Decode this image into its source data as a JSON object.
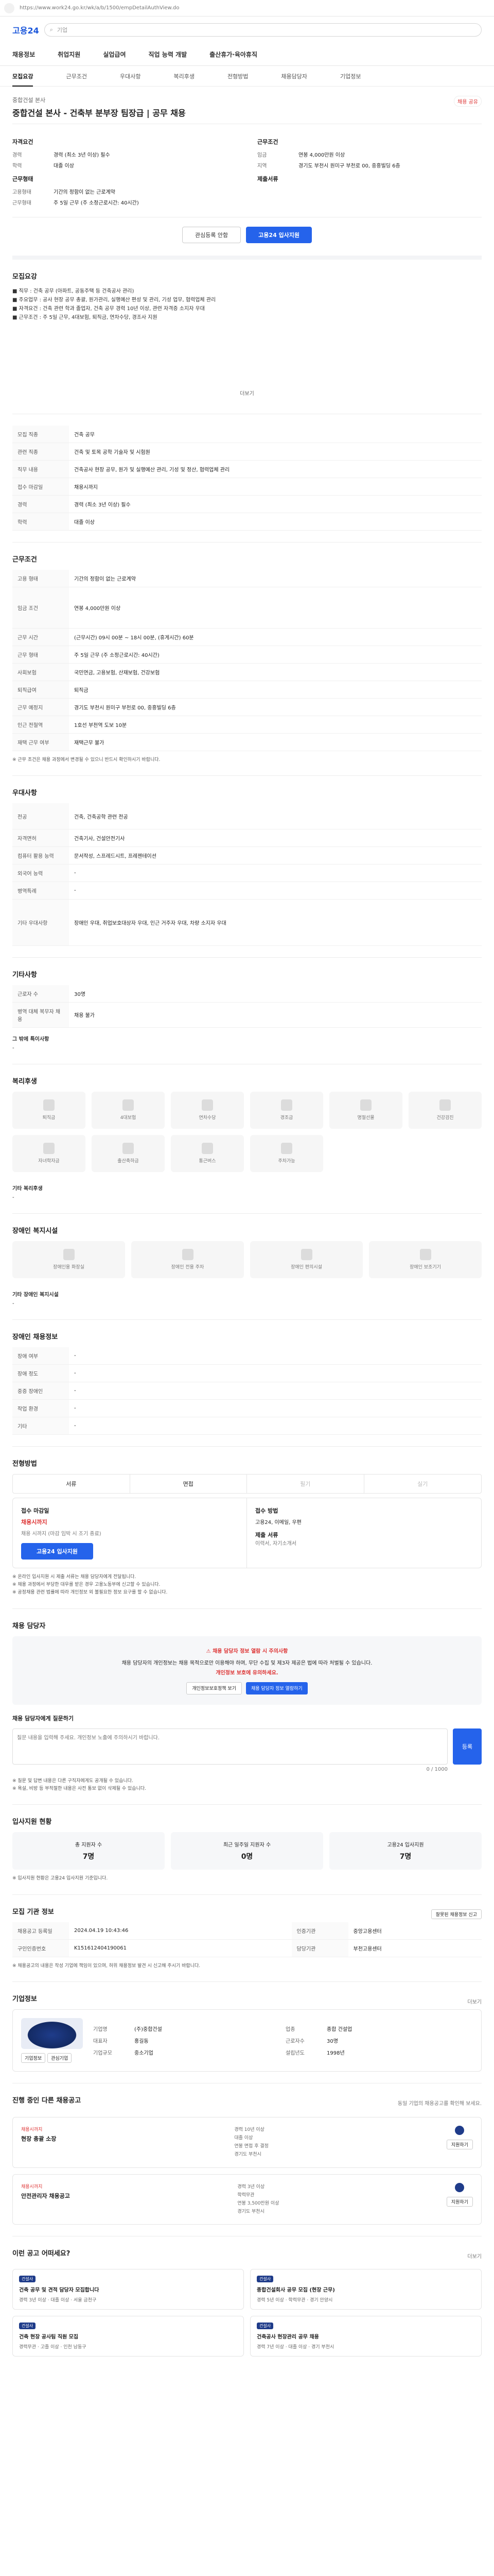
{
  "browser": {
    "url": "https://www.work24.go.kr/wk/a/b/1500/empDetailAuthView.do"
  },
  "brand": {
    "name": "고용24"
  },
  "search": {
    "placeholder": "기업"
  },
  "gnb": [
    "채용정보",
    "취업지원",
    "실업급여",
    "직업 능력 개발",
    "출산휴가·육아휴직"
  ],
  "tabs": [
    "모집요강",
    "근무조건",
    "우대사항",
    "복리후생",
    "전형방법",
    "채용담당자",
    "기업정보"
  ],
  "job": {
    "company": "중합건설 본사",
    "title": "중합건설 본사 - 건축부 분부장 팀장급 | 공무 채용",
    "share": "채용 공유"
  },
  "summary": {
    "left_title": "자격요건",
    "left": [
      {
        "k": "경력",
        "v": "경력 (최소 3년 이상) 필수"
      },
      {
        "k": "학력",
        "v": "대졸 이상"
      }
    ],
    "left_title2": "근무형태",
    "left2": [
      {
        "k": "고용형태",
        "v": "기간의 정함이 없는 근로계약"
      },
      {
        "k": "근무형태",
        "v": "주 5일 근무 (주 소정근로시간: 40시간)"
      }
    ],
    "right_title": "근무조건",
    "right": [
      {
        "k": "임금",
        "v": "연봉 4,000만원 이상"
      },
      {
        "k": "지역",
        "v": "경기도 부천시 원미구 부천로 00, 중흥빌딩 6층"
      }
    ],
    "right_title2": "제출서류",
    "right2": []
  },
  "buttons": {
    "scrap": "관심등록 안함",
    "apply": "고용24 입사지원"
  },
  "recruit": {
    "title": "모집요강",
    "body": [
      "■ 직무 : 건축 공무 (아파트, 공동주택 등 건축공사 관리)",
      "■ 주요업무 : 공사 현장 공무 총괄, 원가관리, 실행예산 편성 및 관리, 기성 업무, 협력업체 관리",
      "■ 자격요건 : 건축 관련 학과 졸업자, 건축 공무 경력 10년 이상, 관련 자격증 소지자 우대",
      "■ 근무조건 : 주 5일 근무, 4대보험, 퇴직금, 연차수당, 경조사 지원"
    ],
    "more": "더보기"
  },
  "recruit_table": [
    {
      "k": "모집 직종",
      "v": "건축 공무"
    },
    {
      "k": "관련 직종",
      "v": "건축 및 토목 공학 기술자 및 시험원"
    },
    {
      "k": "직무 내용",
      "v": "건축공사 현장 공무, 원가 및 실행예산 관리, 기성 및 정산, 협력업체 관리"
    },
    {
      "k": "접수 마감일",
      "v": "채용시까지"
    },
    {
      "k": "경력",
      "v": "경력 (최소 3년 이상) 필수"
    },
    {
      "k": "학력",
      "v": "대졸 이상"
    }
  ],
  "work": {
    "title": "근무조건",
    "rows": [
      {
        "k": "고용 형태",
        "v": "기간의 정함이 없는 근로계약"
      },
      {
        "k": "임금 조건",
        "v": "연봉 4,000만원 이상"
      },
      {
        "k": "근무 시간",
        "v": "(근무시간) 09시 00분 ~ 18시 00분, (휴게시간) 60분"
      },
      {
        "k": "근무 형태",
        "v": "주 5일 근무 (주 소정근로시간: 40시간)"
      },
      {
        "k": "사회보험",
        "v": "국민연금, 고용보험, 산재보험, 건강보험"
      },
      {
        "k": "퇴직급여",
        "v": "퇴직금"
      },
      {
        "k": "근무 예정지",
        "v": "경기도 부천시 원미구 부천로 00, 중흥빌딩 6층"
      },
      {
        "k": "인근 전철역",
        "v": "1호선 부천역 도보 10분"
      },
      {
        "k": "재택 근무 여부",
        "v": "재택근무 불가"
      }
    ],
    "note": "※ 근무 조건은 채용 과정에서 변경될 수 있으니 반드시 확인하시기 바랍니다."
  },
  "prefer": {
    "title": "우대사항",
    "rows": [
      {
        "k": "전공",
        "v": "건축, 건축공학 관련 전공"
      },
      {
        "k": "자격면허",
        "v": "건축기사, 건설안전기사"
      },
      {
        "k": "컴퓨터 활용 능력",
        "v": "문서작성, 스프레드시트, 프레젠테이션"
      },
      {
        "k": "외국어 능력",
        "v": "-"
      },
      {
        "k": "병역특례",
        "v": "-"
      },
      {
        "k": "기타 우대사항",
        "v": "장애인 우대, 취업보호대상자 우대, 인근 거주자 우대, 차량 소지자 우대"
      }
    ]
  },
  "extra": {
    "title": "기타사항",
    "rows": [
      {
        "k": "근로자 수",
        "v": "30명"
      },
      {
        "k": "병역 대체 복무자 채용",
        "v": "채용 불가"
      }
    ],
    "sub": "그 밖에 특이사항",
    "sub_v": "-"
  },
  "welfare": {
    "title": "복리후생",
    "items": [
      "퇴직금",
      "4대보험",
      "연차수당",
      "경조금",
      "명절선물",
      "건강검진",
      "자녀학자금",
      "출산축하금",
      "통근버스",
      "주차가능"
    ],
    "note_title": "기타 복리후생",
    "note_v": "-"
  },
  "disabled": {
    "title": "장애인 복지시설",
    "items": [
      "장애인용 화장실",
      "장애인 전용 주차",
      "장애인 편의시설",
      "장애인 보조기기"
    ],
    "note_title": "기타 장애인 복지시설",
    "note_v": "-"
  },
  "disabled_req": {
    "title": "장애인 채용정보",
    "rows": [
      {
        "k": "장애 여부",
        "v": "-"
      },
      {
        "k": "장애 정도",
        "v": "-"
      },
      {
        "k": "중증 장애인",
        "v": "-"
      },
      {
        "k": "작업 환경",
        "v": "-"
      },
      {
        "k": "기타",
        "v": "-"
      }
    ]
  },
  "process": {
    "title": "전형방법",
    "steps": [
      "서류",
      "면접",
      "필기",
      "실기"
    ],
    "left_title": "접수 마감일",
    "left_value": "채용시까지",
    "left_sub": "채용 시까지 (마감 임박 시 조기 종료)",
    "apply_btn": "고용24 입사지원",
    "right_title": "접수 방법",
    "right_values": [
      "고용24",
      "이메일",
      "우편"
    ],
    "right_sub": "제출 서류",
    "right_sub_v": "이력서, 자기소개서",
    "notice": [
      "※ 온라인 입사지원 시 제출 서류는 채용 담당자에게 전달됩니다.",
      "※ 채용 과정에서 부당한 대우를 받은 경우 고용노동부에 신고할 수 있습니다.",
      "※ 공정채용 관련 법률에 따라 개인정보 외 불필요한 정보 요구를 할 수 없습니다."
    ]
  },
  "contact": {
    "title": "채용 담당자",
    "alert_head": "채용 담당자 정보 열람 시 주의사항",
    "alert_body": "채용 담당자의 개인정보는 채용 목적으로만 이용해야 하며, 무단 수집 및 제3자 제공은 법에 따라 처벌될 수 있습니다.",
    "alert_red": "개인정보 보호에 유의하세요.",
    "btn1": "개인정보보호정책 보기",
    "btn2": "채용 담당자 정보 열람하기",
    "qa_title": "채용 담당자에게 질문하기",
    "qa_placeholder": "질문 내용을 입력해 주세요. 개인정보 노출에 주의하시기 바랍니다.",
    "qa_count": "0 / 1000",
    "qa_btn": "등록",
    "qa_notes": [
      "※ 질문 및 답변 내용은 다른 구직자에게도 공개될 수 있습니다.",
      "※ 욕설, 비방 등 부적절한 내용은 사전 통보 없이 삭제될 수 있습니다."
    ]
  },
  "applicants": {
    "title": "입사지원 현황",
    "stats": [
      {
        "label": "총 지원자 수",
        "num": "7명"
      },
      {
        "label": "최근 일주일 지원자 수",
        "num": "0명"
      },
      {
        "label": "고용24 입사지원",
        "num": "7명"
      }
    ],
    "note": "※ 입사지원 현황은 고용24 입사지원 기준입니다."
  },
  "meta": {
    "title": "모집 기관 정보",
    "report_btn": "잘못된 채용정보 신고",
    "rows": [
      {
        "k": "채용공고 등록일",
        "v": "2024.04.19 10:43:46",
        "k2": "인증기관",
        "v2": "중앙고용센터"
      },
      {
        "k": "구인인증번호",
        "v": "K151612404190061",
        "k2": "담당기관",
        "v2": "부천고용센터"
      }
    ],
    "note": "※ 채용공고의 내용은 작성 기업에 책임이 있으며, 허위 채용정보 발견 시 신고해 주시기 바랍니다."
  },
  "company": {
    "title": "기업정보",
    "more": "더보기",
    "rows": [
      {
        "k": "기업명",
        "v": "(주)중합건설",
        "k2": "업종",
        "v2": "종합 건설업"
      },
      {
        "k": "대표자",
        "v": "홍길동",
        "k2": "근로자수",
        "v2": "30명"
      },
      {
        "k": "기업규모",
        "v": "중소기업",
        "k2": "설립년도",
        "v2": "1998년"
      }
    ],
    "btn1": "기업정보",
    "btn2": "관심기업"
  },
  "others": {
    "title": "진행 중인 다른 채용공고",
    "sub": "동일 기업의 채용공고를 확인해 보세요.",
    "items": [
      {
        "tag": "채용시까지",
        "name": "현장 총괄 소장",
        "meta": [
          "경력 10년 이상",
          "대졸 이상",
          "연봉 면접 후 결정",
          "경기도 부천시"
        ],
        "btn": "지원하기"
      },
      {
        "tag": "채용시까지",
        "name": "안전관리자 채용공고",
        "meta": [
          "경력 3년 이상",
          "학력무관",
          "연봉 3,500만원 이상",
          "경기도 부천시"
        ],
        "btn": "지원하기"
      }
    ]
  },
  "recommend": {
    "title": "이런 공고 어떠세요?",
    "more": "더보기",
    "items": [
      {
        "co": "건설사",
        "ttl": "건축 공무 및 견적 담당자 모집합니다",
        "small": "경력 3년 이상 · 대졸 이상 · 서울 금천구"
      },
      {
        "co": "건설사",
        "ttl": "종합건설회사 공무 모집 (현장 근무)",
        "small": "경력 5년 이상 · 학력무관 · 경기 안양시"
      },
      {
        "co": "건설사",
        "ttl": "건축 현장 공사팀 직원 모집",
        "small": "경력무관 · 고졸 이상 · 인천 남동구"
      },
      {
        "co": "건설사",
        "ttl": "건축공사 현장관리 공무 채용",
        "small": "경력 7년 이상 · 대졸 이상 · 경기 부천시"
      }
    ]
  }
}
